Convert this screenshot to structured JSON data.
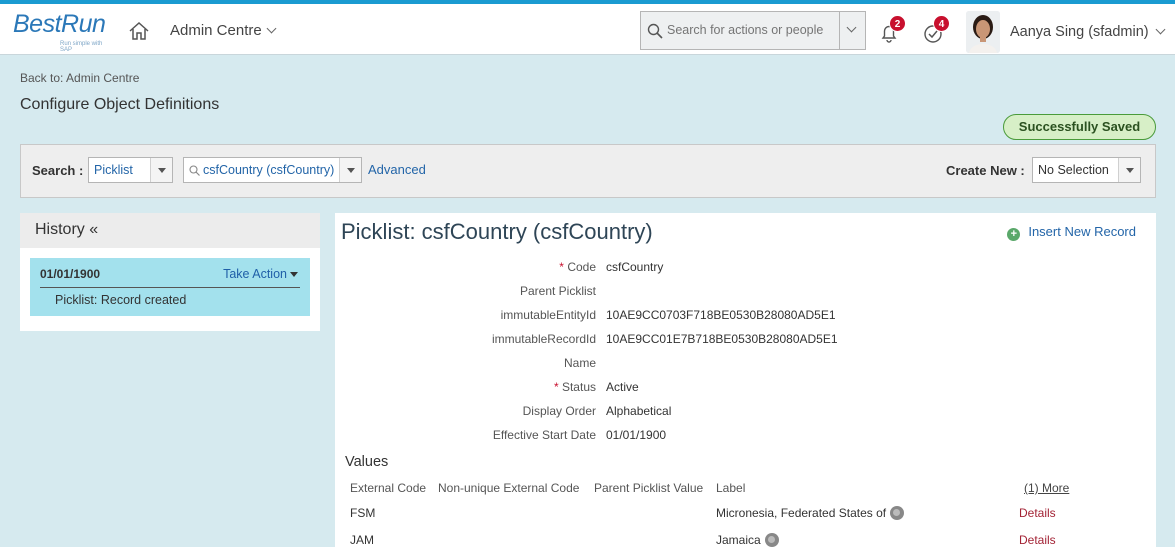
{
  "header": {
    "logo_text": "BestRun",
    "logo_tagline": "Run simple with SAP",
    "menu_label": "Admin Centre",
    "search_placeholder": "Search for actions or people",
    "notifications_count": "2",
    "todo_count": "4",
    "user_name": "Aanya Sing (sfadmin)"
  },
  "page": {
    "back_link": "Back to: Admin Centre",
    "title": "Configure Object Definitions",
    "saved_message": "Successfully Saved"
  },
  "search_bar": {
    "search_label": "Search :",
    "type_value": "Picklist",
    "object_value": "csfCountry (csfCountry)",
    "advanced_label": "Advanced",
    "create_label": "Create New :",
    "create_value": "No Selection"
  },
  "history": {
    "title": "History «",
    "items": [
      {
        "date": "01/01/1900",
        "action": "Take Action",
        "description": "Picklist: Record created"
      }
    ]
  },
  "record": {
    "title": "Picklist: csfCountry (csfCountry)",
    "insert_label": "Insert New Record",
    "fields": [
      {
        "label": "Code",
        "required": "*",
        "value": "csfCountry"
      },
      {
        "label": "Parent Picklist",
        "required": "",
        "value": ""
      },
      {
        "label": "immutableEntityId",
        "required": "",
        "value": "10AE9CC0703F718BE0530B28080AD5E1"
      },
      {
        "label": "immutableRecordId",
        "required": "",
        "value": "10AE9CC01E7B718BE0530B28080AD5E1"
      },
      {
        "label": "Name",
        "required": "",
        "value": ""
      },
      {
        "label": "Status",
        "required": "*",
        "value": "Active"
      },
      {
        "label": "Display Order",
        "required": "",
        "value": "Alphabetical"
      },
      {
        "label": "Effective Start Date",
        "required": "",
        "value": "01/01/1900"
      }
    ],
    "values_title": "Values",
    "columns": [
      "External Code",
      "Non-unique External Code",
      "Parent Picklist Value",
      "Label"
    ],
    "more_label": "(1) More",
    "rows": [
      {
        "code": "FSM",
        "label": "Micronesia, Federated States of",
        "details": "Details"
      },
      {
        "code": "JAM",
        "label": "Jamaica",
        "details": "Details"
      }
    ]
  },
  "colors": {
    "accent": "#1a9bd1",
    "page_bg": "#d6eaef",
    "history_item_bg": "#a3e1ed",
    "saved_bg": "#d7efc7",
    "badge": "#c8102e",
    "details_link": "#a32335"
  },
  "icons": [
    "home-icon",
    "search-icon",
    "bell-icon",
    "checkmark-circle-icon",
    "globe-icon",
    "plus-circle-icon"
  ]
}
